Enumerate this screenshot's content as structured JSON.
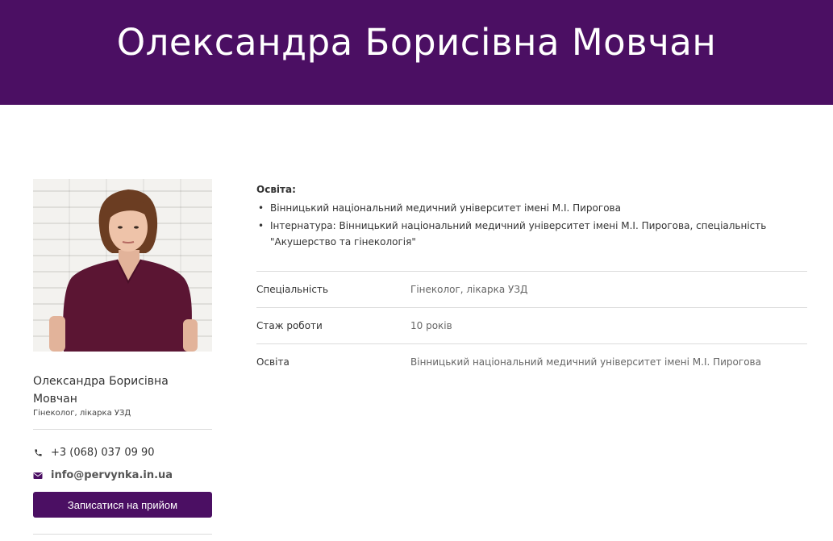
{
  "header": {
    "title": "Олександра Борисівна Мовчан"
  },
  "profile": {
    "name": "Олександра Борисівна Мовчан",
    "role": "Гінеколог, лікарка УЗД",
    "phone": "+3 (068) 037 09 90",
    "email": "info@pervynka.in.ua",
    "appointment_button": "Записатися на прийом"
  },
  "education_block": {
    "title": "Освіта:",
    "items": [
      "Вінницький національний медичний університет імені М.І. Пирогова",
      "Інтернатура: Вінницький національний медичний університет імені М.І. Пирогова, спеціальність \"Акушерство та гінекологія\""
    ]
  },
  "details": [
    {
      "key": "Спеціальність",
      "value": "Гінеколог, лікарка УЗД"
    },
    {
      "key": "Стаж роботи",
      "value": "10 років"
    },
    {
      "key": "Освіта",
      "value": "Вінницький національний медичний університет імені М.І. Пирогова"
    }
  ],
  "colors": {
    "brand": "#4b0f63",
    "scrub": "#5b1533"
  }
}
